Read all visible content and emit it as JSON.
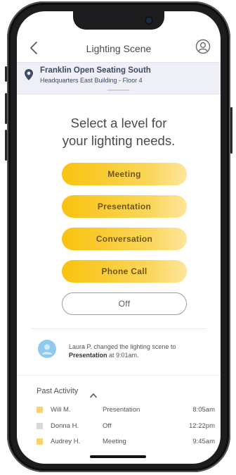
{
  "header": {
    "title": "Lighting Scene"
  },
  "location": {
    "name": "Franklin Open Seating South",
    "detail": "Headquarters East Building - Floor 4"
  },
  "heading": {
    "line1": "Select a level for",
    "line2": "your lighting needs."
  },
  "scenes": [
    {
      "label": "Meeting"
    },
    {
      "label": "Presentation"
    },
    {
      "label": "Conversation"
    },
    {
      "label": "Phone Call"
    },
    {
      "label": "Off"
    }
  ],
  "notice": {
    "text": "Laura P. changed the lighting scene to ",
    "scene": "Presentation",
    "suffix": " at 9:01am."
  },
  "past_activity": {
    "title": "Past Activity",
    "rows": [
      {
        "name": "Will M.",
        "scene": "Presentation",
        "time": "8:05am",
        "color": "#f9d36b"
      },
      {
        "name": "Donna H.",
        "scene": "Off",
        "time": "12:22pm",
        "color": "#d6d8de"
      },
      {
        "name": "Audrey H.",
        "scene": "Meeting",
        "time": "9:45am",
        "color": "#f9d36b"
      }
    ]
  },
  "colors": {
    "accent": "#f9c20f",
    "location_bg": "#eef0f5",
    "avatar": "#8ec9ee"
  },
  "icons": [
    "back-chevron-icon",
    "user-profile-icon",
    "location-pin-icon",
    "user-avatar-icon",
    "caret-up-icon"
  ]
}
